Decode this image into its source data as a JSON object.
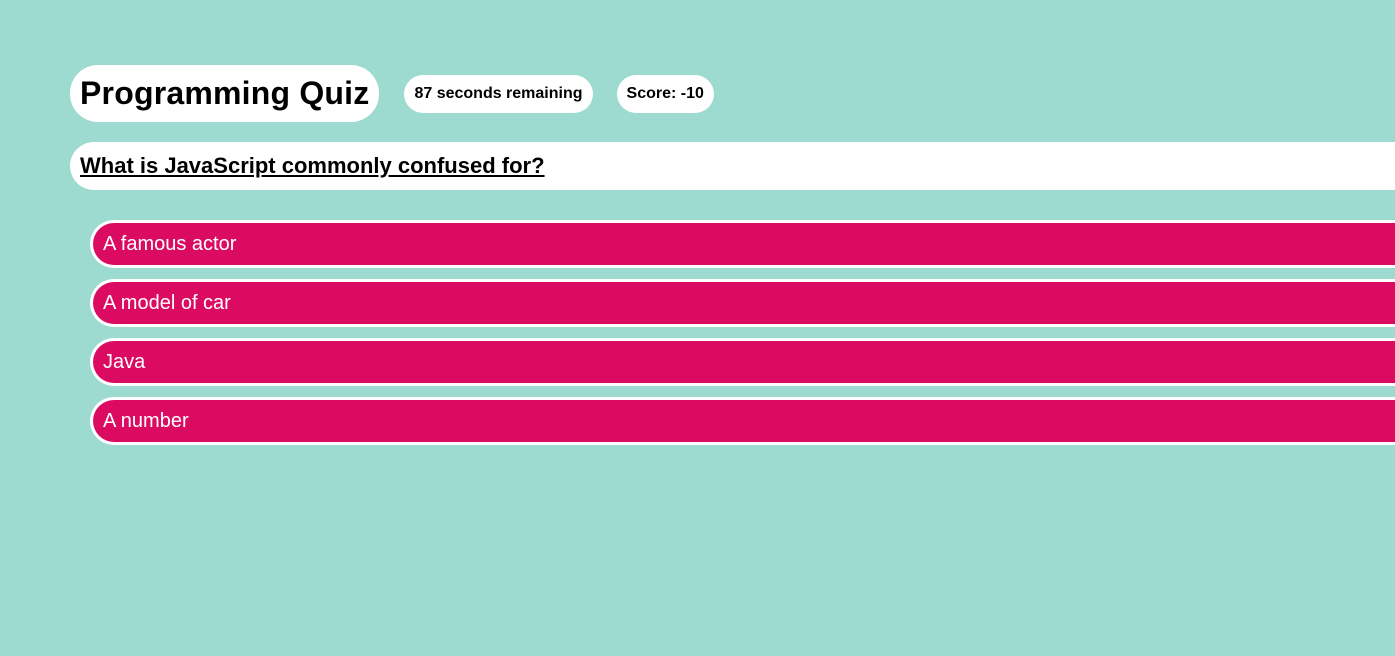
{
  "header": {
    "title": "Programming Quiz",
    "timer_text": "87 seconds remaining",
    "score_text": "Score: -10"
  },
  "question": {
    "text": "What is JavaScript commonly confused for?"
  },
  "answers": [
    {
      "label": "A famous actor"
    },
    {
      "label": "A model of car"
    },
    {
      "label": "Java"
    },
    {
      "label": "A number"
    }
  ],
  "colors": {
    "background": "#9ddad0",
    "answer_bg": "#dc0b62",
    "pill_bg": "#ffffff"
  }
}
